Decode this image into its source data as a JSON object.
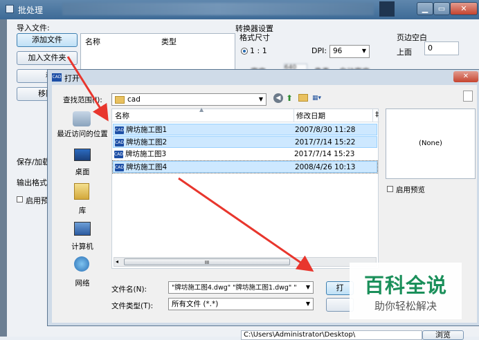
{
  "window": {
    "title": "批处理"
  },
  "left": {
    "import_label": "导入文件:",
    "add_file": "添加文件",
    "add_folder": "加入文件夹",
    "move_partial": "移",
    "remove_partial": "移除",
    "col_name": "名称",
    "col_type": "类型",
    "save_load": "保存/加载",
    "output_format": "输出格式:",
    "enable_preview_partial": "启用预"
  },
  "converter": {
    "title": "转换器设置",
    "format_size": "格式尺寸",
    "ratio": "1 : 1",
    "dpi_label": "DPI:",
    "dpi_value": "96",
    "margin_title": "页边空白",
    "top_label": "上面",
    "top_value": "0",
    "width_label": "宽度",
    "width_value": "640",
    "pixel": "像素",
    "auto_width": "自动宽度",
    "path": "C:\\Users\\Administrator\\Desktop\\",
    "browse": "浏览"
  },
  "dialog": {
    "title": "打开",
    "lookin_label": "查找范围(I):",
    "lookin_value": "cad",
    "places": [
      {
        "label": "最近访问的位置",
        "icon": "recent-places-icon"
      },
      {
        "label": "桌面",
        "icon": "desktop-icon"
      },
      {
        "label": "库",
        "icon": "library-icon"
      },
      {
        "label": "计算机",
        "icon": "computer-icon"
      },
      {
        "label": "网络",
        "icon": "network-icon"
      }
    ],
    "col_name": "名称",
    "col_date": "修改日期",
    "col_extra": "‡",
    "files": [
      {
        "name": "牌坊施工图1",
        "date": "2007/8/30 11:28",
        "selected": true
      },
      {
        "name": "牌坊施工图2",
        "date": "2017/7/14 15:22",
        "selected": true
      },
      {
        "name": "牌坊施工图3",
        "date": "2017/7/14 15:23",
        "selected": false
      },
      {
        "name": "牌坊施工图4",
        "date": "2008/4/26 10:13",
        "selected": true
      }
    ],
    "preview_text": "(None)",
    "enable_preview": "启用预览",
    "filename_label": "文件名(N):",
    "filename_value": "\"牌坊施工图4.dwg\" \"牌坊施工图1.dwg\" \"",
    "filetype_label": "文件类型(T):",
    "filetype_value": "所有文件 (*.*)",
    "open_button": "打",
    "scroll_mid": "III"
  },
  "watermark": {
    "main": "百科全说",
    "sub": "助你轻松解决",
    "color": "#1a8f5a"
  },
  "colors": {
    "arrow": "#e8362d",
    "accent": "#3c7fb1"
  }
}
